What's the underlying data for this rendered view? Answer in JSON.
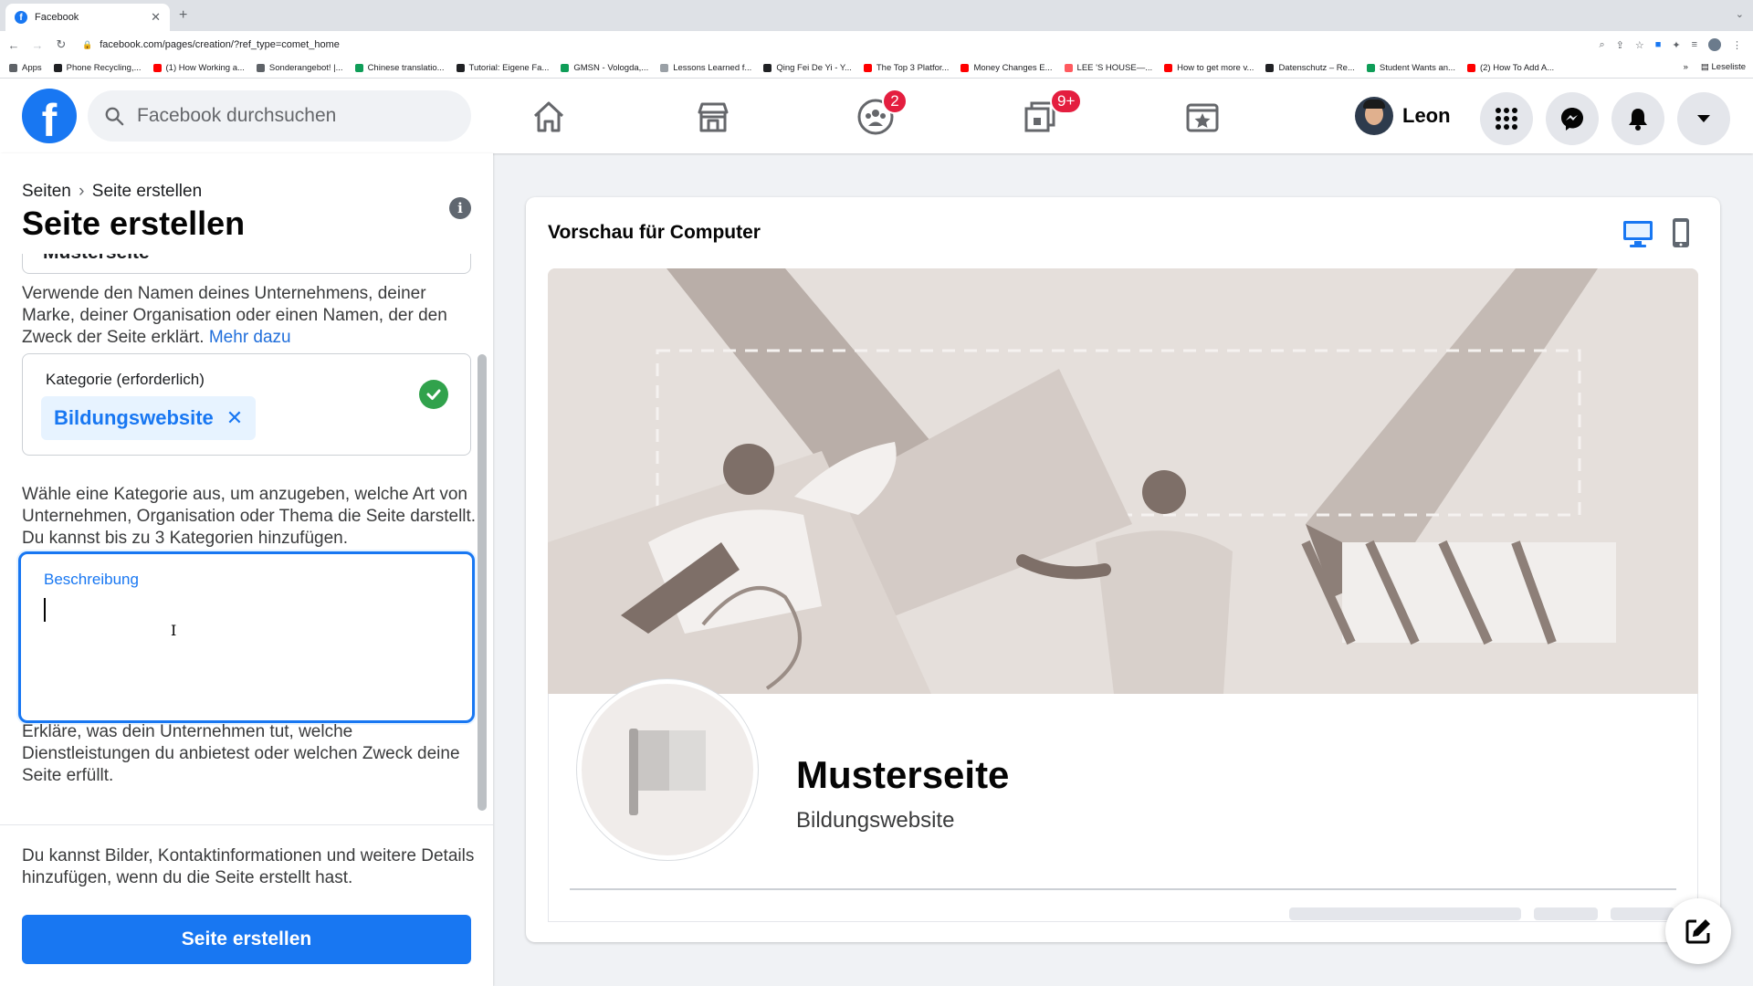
{
  "browser": {
    "tab_title": "Facebook",
    "tab_favicon": "f",
    "url": "facebook.com/pages/creation/?ref_type=comet_home",
    "bookmarks": [
      {
        "label": "Apps",
        "color": "#5f6368"
      },
      {
        "label": "Phone Recycling,...",
        "color": "#202124"
      },
      {
        "label": "(1) How Working a...",
        "color": "#ff0000"
      },
      {
        "label": "Sonderangebot! |...",
        "color": "#5f6368"
      },
      {
        "label": "Chinese translatio...",
        "color": "#0f9d58"
      },
      {
        "label": "Tutorial: Eigene Fa...",
        "color": "#202124"
      },
      {
        "label": "GMSN - Vologda,...",
        "color": "#0f9d58"
      },
      {
        "label": "Lessons Learned f...",
        "color": "#9aa0a6"
      },
      {
        "label": "Qing Fei De Yi - Y...",
        "color": "#202124"
      },
      {
        "label": "The Top 3 Platfor...",
        "color": "#ff0000"
      },
      {
        "label": "Money Changes E...",
        "color": "#ff0000"
      },
      {
        "label": "LEE 'S HOUSE—...",
        "color": "#ff5a5f"
      },
      {
        "label": "How to get more v...",
        "color": "#ff0000"
      },
      {
        "label": "Datenschutz – Re...",
        "color": "#202124"
      },
      {
        "label": "Student Wants an...",
        "color": "#0f9d58"
      },
      {
        "label": "(2) How To Add A...",
        "color": "#ff0000"
      }
    ],
    "bookmarks_more": "»",
    "reading_list": "Leseliste"
  },
  "fbnav": {
    "search_placeholder": "Facebook durchsuchen",
    "groups_badge": "2",
    "gaming_badge": "9+",
    "profile_name": "Leon"
  },
  "left": {
    "breadcrumb_root": "Seiten",
    "breadcrumb_sep": "›",
    "breadcrumb_current": "Seite erstellen",
    "title": "Seite erstellen",
    "name_value": "Musterseite",
    "name_help": "Verwende den Namen deines Unternehmens, deiner Marke, deiner Organisation oder einen Namen, der den Zweck der Seite erklärt.",
    "name_help_link": "Mehr dazu",
    "category_label": "Kategorie (erforderlich)",
    "category_chip": "Bildungswebsite",
    "category_help": "Wähle eine Kategorie aus, um anzugeben, welche Art von Unternehmen, Organisation oder Thema die Seite darstellt. Du kannst bis zu 3 Kategorien hinzufügen.",
    "description_label": "Beschreibung",
    "description_value": "",
    "description_help": "Erkläre, was dein Unternehmen tut, welche Dienstleistungen du anbietest oder welchen Zweck deine Seite erfüllt.",
    "footer_note": "Du kannst Bilder, Kontaktinformationen und weitere Details hinzufügen, wenn du die Seite erstellt hast.",
    "create_button": "Seite erstellen"
  },
  "preview": {
    "title": "Vorschau für Computer",
    "page_name": "Musterseite",
    "page_category": "Bildungswebsite",
    "active_device": "desktop"
  },
  "colors": {
    "brand": "#1877f2",
    "success": "#31a24c",
    "badge": "#e41e3f"
  }
}
